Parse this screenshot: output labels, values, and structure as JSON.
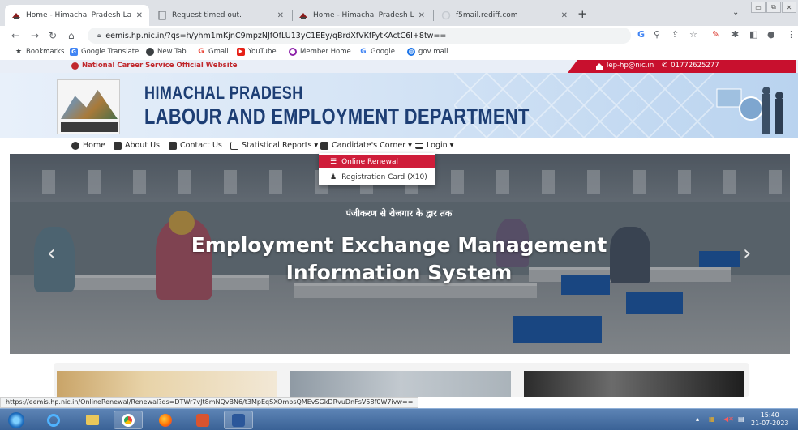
{
  "browser": {
    "tabs": [
      {
        "title": "Home - Himachal Pradesh Labou",
        "active": true
      },
      {
        "title": "Request timed out.",
        "active": false
      },
      {
        "title": "Home - Himachal Pradesh Labou",
        "active": false
      },
      {
        "title": "f5mail.rediff.com",
        "active": false
      }
    ],
    "new_tab": "+",
    "url": "eemis.hp.nic.in/?qs=h/yhm1mKjnC9mpzNJfOfLU13yC1EEy/qBrdXfVKfFytKActC6I+8tw==",
    "bookmarks": [
      {
        "label": "Bookmarks",
        "icon": "star-icon"
      },
      {
        "label": "Google Translate",
        "icon": "translate-icon"
      },
      {
        "label": "New Tab",
        "icon": "globe-icon"
      },
      {
        "label": "Gmail",
        "icon": "google-icon"
      },
      {
        "label": "YouTube",
        "icon": "youtube-icon"
      },
      {
        "label": "Member Home",
        "icon": "member-icon"
      },
      {
        "label": "Google",
        "icon": "google-icon"
      },
      {
        "label": "gov mail",
        "icon": "mail-icon"
      }
    ],
    "status_url": "https://eemis.hp.nic.in/OnlineRenewal/Renewal?qs=DTWr7vJt8mNQvBN6/t3MpEqSXOmbsQMEvSGkDRvuDnFsV58f0W7ivw=="
  },
  "site": {
    "official_text": "National Career Service Official Website",
    "email": "lep-hp@nic.in",
    "phone": "01772625277",
    "title_line1": "HIMACHAL PRADESH",
    "title_line2": "LABOUR AND EMPLOYMENT DEPARTMENT",
    "nav": [
      {
        "label": "Home",
        "icon": "globe-icon"
      },
      {
        "label": "About Us",
        "icon": "users-icon"
      },
      {
        "label": "Contact Us",
        "icon": "contact-icon"
      },
      {
        "label": "Statistical Reports",
        "icon": "chart-icon",
        "caret": "▾"
      },
      {
        "label": "Candidate's Corner",
        "icon": "id-card-icon",
        "caret": "▾"
      },
      {
        "label": "Login",
        "icon": "menu-icon",
        "caret": "▾"
      }
    ],
    "dropdown": [
      {
        "label": "Online Renewal",
        "icon": "list-icon",
        "highlighted": true
      },
      {
        "label": "Registration Card (X10)",
        "icon": "user-icon",
        "highlighted": false
      }
    ],
    "hero_small": "पंजीकरण से रोजगार के द्वार तक",
    "hero_line1": "Employment Exchange Management",
    "hero_line2": "Information System",
    "prev": "‹",
    "next": "›"
  },
  "taskbar": {
    "time": "15:40",
    "date": "21-07-2023"
  },
  "colors": {
    "brand_red": "#c8102e",
    "title_blue": "#1d3e74",
    "dropdown_active": "#cf1d3a"
  }
}
